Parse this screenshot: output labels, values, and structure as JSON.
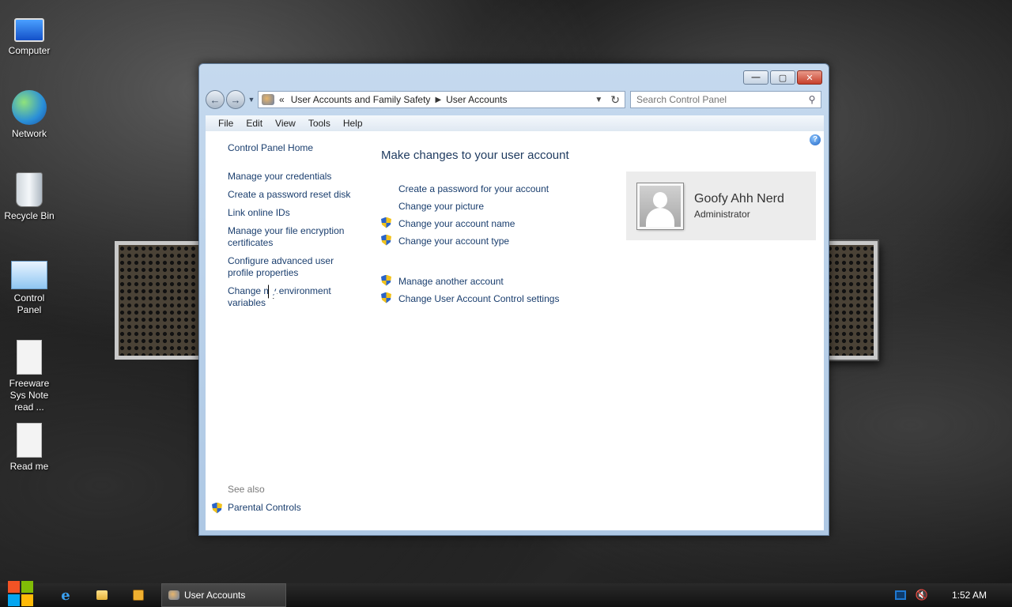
{
  "desktop": {
    "icons": [
      {
        "label": "Computer"
      },
      {
        "label": "Network"
      },
      {
        "label": "Recycle Bin"
      },
      {
        "label": "Control Panel"
      },
      {
        "label": "Freeware Sys Note read ..."
      },
      {
        "label": "Read me"
      }
    ]
  },
  "window": {
    "controls": {
      "minimize": "—",
      "maximize": "▢",
      "close": "✕"
    },
    "nav": {
      "back": "←",
      "forward": "→",
      "breadcrumb_prefix": "«",
      "breadcrumb": [
        "User Accounts and Family Safety",
        "User Accounts"
      ],
      "search_placeholder": "Search Control Panel"
    },
    "menu": [
      "File",
      "Edit",
      "View",
      "Tools",
      "Help"
    ],
    "left_pane": {
      "home": "Control Panel Home",
      "tasks": [
        "Manage your credentials",
        "Create a password reset disk",
        "Link online IDs",
        "Manage your file encryption certificates",
        "Configure advanced user profile properties",
        "Change my environment variables"
      ],
      "see_also_heading": "See also",
      "see_also_links": [
        "Parental Controls"
      ]
    },
    "main": {
      "title": "Make changes to your user account",
      "tasks": [
        "Create a password for your account",
        "Change your picture",
        "Change your account name",
        "Change your account type"
      ],
      "other_tasks": [
        "Manage another account",
        "Change User Account Control settings"
      ]
    },
    "user": {
      "name": "Goofy Ahh Nerd",
      "role": "Administrator"
    },
    "help_glyph": "?"
  },
  "taskbar": {
    "active_window": "User Accounts",
    "ie_glyph": "e",
    "clock": "1:52 AM",
    "colors": {
      "start_red": "#f35325",
      "start_green": "#81bc06",
      "start_blue": "#05a6f0",
      "start_yellow": "#ffba08"
    }
  }
}
